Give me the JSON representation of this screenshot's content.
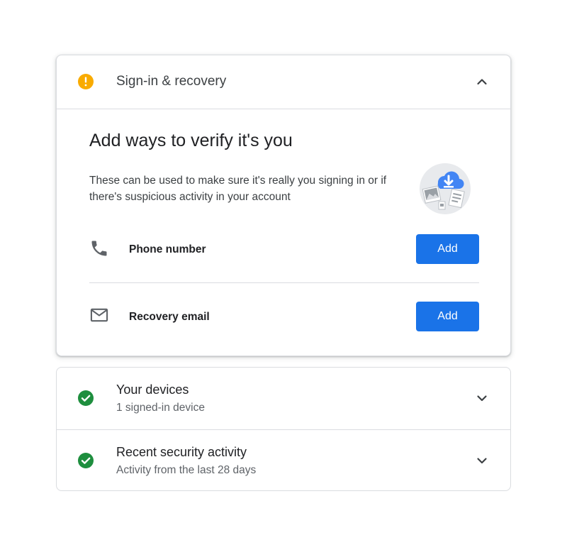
{
  "signin_recovery": {
    "title": "Sign-in & recovery",
    "status_icon": "warning-icon",
    "status_color": "#f9ab00",
    "expanded": true,
    "heading": "Add ways to verify it's you",
    "description": "These can be used to make sure it's really you signing in or if there's suspicious activity in your account",
    "illustration": "cloud-download-illustration",
    "items": [
      {
        "label": "Phone number",
        "icon": "phone-icon",
        "button_label": "Add"
      },
      {
        "label": "Recovery email",
        "icon": "email-icon",
        "button_label": "Add"
      }
    ]
  },
  "sections": [
    {
      "title": "Your devices",
      "subtitle": "1 signed-in device",
      "status_icon": "check-circle-icon",
      "status_color": "#1e8e3e"
    },
    {
      "title": "Recent security activity",
      "subtitle": "Activity from the last 28 days",
      "status_icon": "check-circle-icon",
      "status_color": "#1e8e3e"
    }
  ],
  "colors": {
    "accent": "#1a73e8",
    "warning": "#f9ab00",
    "success": "#1e8e3e",
    "divider": "#dadce0"
  }
}
